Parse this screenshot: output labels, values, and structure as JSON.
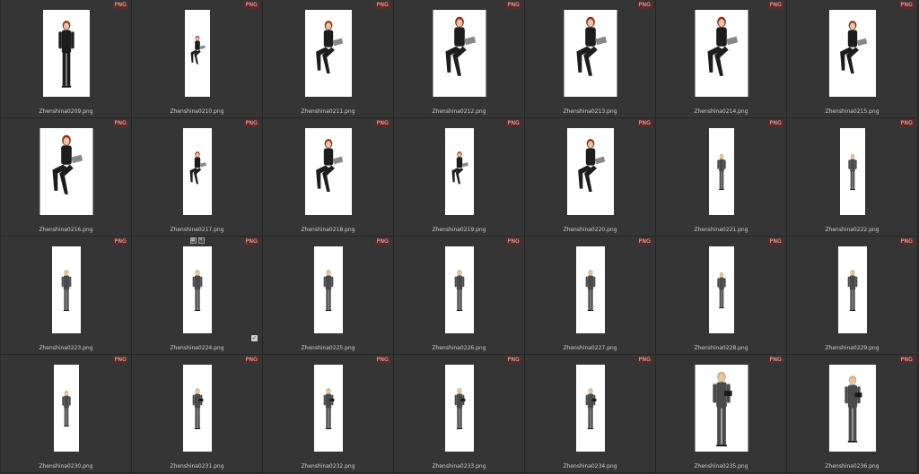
{
  "badge": "PNG",
  "colors": {
    "background": "#2b2b2b",
    "cell": "#353535",
    "badge_bg": "#5a2a2a",
    "badge_fg": "#f0c8c0",
    "thumb_bg": "#ffffff"
  },
  "tiles": [
    {
      "file": "Zhenshina0209.png",
      "kind": "redhead-standing-laptop",
      "shape": "medium"
    },
    {
      "file": "Zhenshina0210.png",
      "kind": "redhead-seated-laptop",
      "shape": "narrow"
    },
    {
      "file": "Zhenshina0211.png",
      "kind": "redhead-seated-laptop",
      "shape": "medium"
    },
    {
      "file": "Zhenshina0212.png",
      "kind": "redhead-seated-laptop",
      "shape": "wide"
    },
    {
      "file": "Zhenshina0213.png",
      "kind": "redhead-seated-pointing",
      "shape": "wide"
    },
    {
      "file": "Zhenshina0214.png",
      "kind": "redhead-seated-phone",
      "shape": "wide"
    },
    {
      "file": "Zhenshina0215.png",
      "kind": "redhead-seated-laptop",
      "shape": "medium"
    },
    {
      "file": "Zhenshina0216.png",
      "kind": "redhead-seated-laptop",
      "shape": "wide"
    },
    {
      "file": "Zhenshina0217.png",
      "kind": "redhead-seated-tablet",
      "shape": "slim"
    },
    {
      "file": "Zhenshina0218.png",
      "kind": "redhead-seated-tablet",
      "shape": "medium"
    },
    {
      "file": "Zhenshina0219.png",
      "kind": "redhead-seated-tablet",
      "shape": "slim"
    },
    {
      "file": "Zhenshina0220.png",
      "kind": "redhead-seated-pointing",
      "shape": "medium"
    },
    {
      "file": "Zhenshina0221.png",
      "kind": "blonde-standing-suit",
      "shape": "narrow"
    },
    {
      "file": "Zhenshina0222.png",
      "kind": "blonde-standing-suit",
      "shape": "narrow"
    },
    {
      "file": "Zhenshina0223.png",
      "kind": "blonde-standing-suit",
      "shape": "slim"
    },
    {
      "file": "Zhenshina0224.png",
      "kind": "blonde-standing-suit",
      "shape": "slim",
      "selected": true
    },
    {
      "file": "Zhenshina0225.png",
      "kind": "blonde-standing-suit",
      "shape": "slim"
    },
    {
      "file": "Zhenshina0226.png",
      "kind": "blonde-standing-suit",
      "shape": "slim"
    },
    {
      "file": "Zhenshina0227.png",
      "kind": "blonde-standing-suit",
      "shape": "slim"
    },
    {
      "file": "Zhenshina0228.png",
      "kind": "blonde-standing-suit",
      "shape": "narrow"
    },
    {
      "file": "Zhenshina0229.png",
      "kind": "blonde-standing-suit",
      "shape": "slim"
    },
    {
      "file": "Zhenshina0230.png",
      "kind": "blonde-standing-suit",
      "shape": "narrow"
    },
    {
      "file": "Zhenshina0231.png",
      "kind": "blonde-standing-folder",
      "shape": "slim"
    },
    {
      "file": "Zhenshina0232.png",
      "kind": "blonde-standing-folder",
      "shape": "slim"
    },
    {
      "file": "Zhenshina0233.png",
      "kind": "blonde-standing-folder",
      "shape": "slim"
    },
    {
      "file": "Zhenshina0234.png",
      "kind": "blonde-standing-folder",
      "shape": "slim"
    },
    {
      "file": "Zhenshina0235.png",
      "kind": "blonde-standing-folder",
      "shape": "wide"
    },
    {
      "file": "Zhenshina0236.png",
      "kind": "blonde-standing-tablet",
      "shape": "medium"
    }
  ]
}
